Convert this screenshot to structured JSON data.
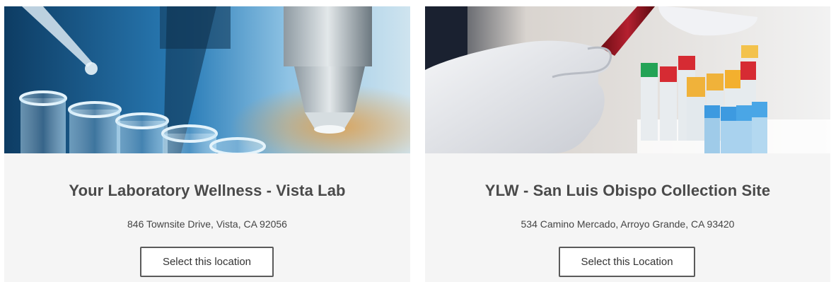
{
  "locations": [
    {
      "image": "laboratory-test-tubes-microscope-photo",
      "title": "Your Laboratory Wellness - Vista Lab",
      "address": "846 Townsite Drive, Vista, CA 92056",
      "button_label": "Select this location"
    },
    {
      "image": "gloved-hand-blood-sample-tubes-photo",
      "title": "YLW - San Luis Obispo Collection Site",
      "address": "534 Camino Mercado, Arroyo Grande, CA 93420",
      "button_label": "Select this Location"
    }
  ],
  "colors": {
    "card_background": "#f5f5f5",
    "title_text": "#4a4a4a",
    "button_border": "#5a5a5a"
  }
}
